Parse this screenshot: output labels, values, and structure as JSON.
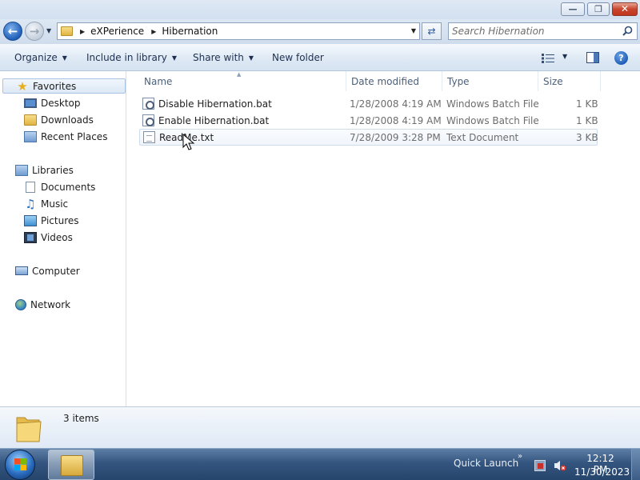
{
  "window": {
    "minimize_glyph": "—",
    "maximize_glyph": "❐",
    "close_glyph": "✕"
  },
  "address": {
    "crumbs": [
      "eXPerience",
      "Hibernation"
    ],
    "search_placeholder": "Search Hibernation"
  },
  "toolbar": {
    "organize": "Organize",
    "include_in_library": "Include in library",
    "share_with": "Share with",
    "new_folder": "New folder",
    "dropdown_glyph": "▼"
  },
  "nav": {
    "favorites": "Favorites",
    "desktop": "Desktop",
    "downloads": "Downloads",
    "recent_places": "Recent Places",
    "libraries": "Libraries",
    "documents": "Documents",
    "music": "Music",
    "pictures": "Pictures",
    "videos": "Videos",
    "computer": "Computer",
    "network": "Network"
  },
  "columns": {
    "name": "Name",
    "date_modified": "Date modified",
    "type": "Type",
    "size": "Size"
  },
  "files": [
    {
      "name": "Disable Hibernation.bat",
      "date": "1/28/2008 4:19 AM",
      "type": "Windows Batch File",
      "size": "1 KB",
      "icon": "batch-file-icon"
    },
    {
      "name": "Enable Hibernation.bat",
      "date": "1/28/2008 4:19 AM",
      "type": "Windows Batch File",
      "size": "1 KB",
      "icon": "batch-file-icon"
    },
    {
      "name": "ReadMe.txt",
      "date": "7/28/2009 3:28 PM",
      "type": "Text Document",
      "size": "3 KB",
      "icon": "text-file-icon"
    }
  ],
  "details": {
    "count": "3 items"
  },
  "taskbar": {
    "quick_launch": "Quick Launch",
    "chevron": "»",
    "time": "12:12 PM",
    "date": "11/30/2023"
  },
  "colors": {
    "accent": "#1f5fb7",
    "taskbar": "#34557f",
    "selection_border": "#a9c4e3"
  }
}
